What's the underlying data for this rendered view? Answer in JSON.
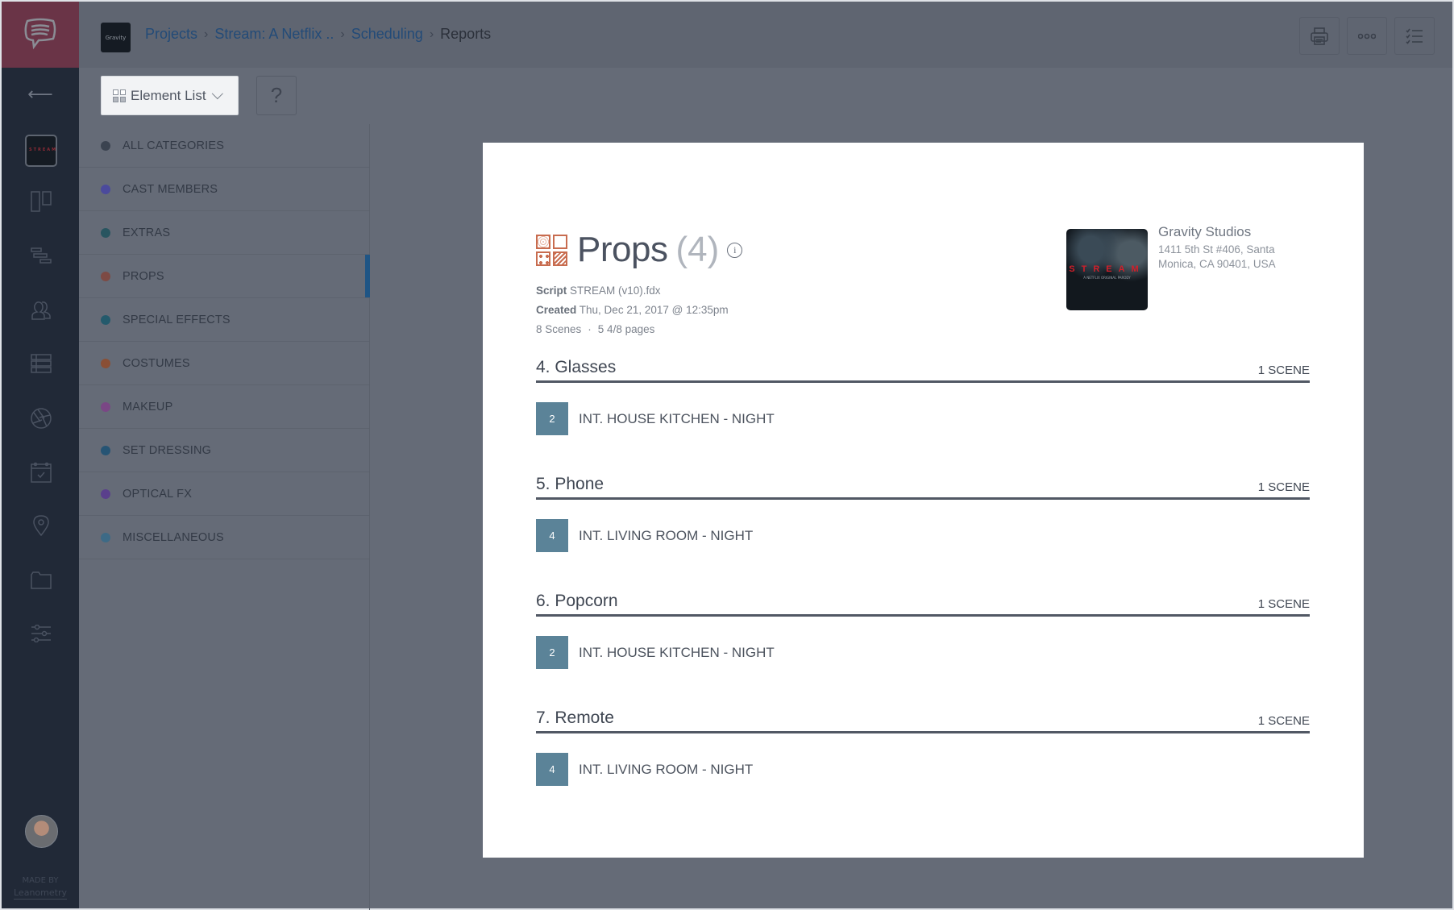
{
  "app": {
    "logo_icon": "chat-bubble-logo-icon",
    "made_by_label": "MADE BY",
    "made_by_brand": "Leanometry"
  },
  "rail": {
    "back_icon": "arrow-left-icon",
    "items": [
      {
        "name": "project-thumbnail",
        "label": "STREAM"
      },
      {
        "name": "board-icon"
      },
      {
        "name": "schedule-stripboard-icon"
      },
      {
        "name": "cast-icon"
      },
      {
        "name": "breakdown-list-icon"
      },
      {
        "name": "shot-aperture-icon"
      },
      {
        "name": "calendar-icon"
      },
      {
        "name": "location-pin-icon"
      },
      {
        "name": "folder-icon"
      },
      {
        "name": "settings-sliders-icon"
      }
    ]
  },
  "topbar": {
    "project_logo_text": "Gravity",
    "breadcrumb": [
      {
        "label": "Projects",
        "link": true
      },
      {
        "label": "Stream: A Netflix ..",
        "link": true
      },
      {
        "label": "Scheduling",
        "link": true
      },
      {
        "label": "Reports",
        "link": false
      }
    ],
    "actions": [
      {
        "name": "print-icon"
      },
      {
        "name": "more-options-icon"
      },
      {
        "name": "checklist-icon"
      }
    ]
  },
  "toolbar": {
    "view_selector": "Element List",
    "help_label": "?"
  },
  "categories": [
    {
      "label": "ALL CATEGORIES",
      "color": "#3b4350",
      "active": false
    },
    {
      "label": "CAST MEMBERS",
      "color": "#4b4a9c",
      "active": false
    },
    {
      "label": "EXTRAS",
      "color": "#285560",
      "active": false
    },
    {
      "label": "PROPS",
      "color": "#7d4a44",
      "active": true
    },
    {
      "label": "SPECIAL EFFECTS",
      "color": "#245a6c",
      "active": false
    },
    {
      "label": "COSTUMES",
      "color": "#8a4f35",
      "active": false
    },
    {
      "label": "MAKEUP",
      "color": "#7a4785",
      "active": false
    },
    {
      "label": "SET DRESSING",
      "color": "#265474",
      "active": false
    },
    {
      "label": "OPTICAL FX",
      "color": "#5a3f8c",
      "active": false
    },
    {
      "label": "MISCELLANEOUS",
      "color": "#3d6a86",
      "active": false
    }
  ],
  "report": {
    "category_icon": "props-category-icon",
    "title": "Props",
    "count": "(4)",
    "script_label": "Script",
    "script_value": "STREAM (v10).fdx",
    "created_label": "Created",
    "created_value": "Thu, Dec 21, 2017 @ 12:35pm",
    "scenes_summary": "8 Scenes",
    "pages_summary": "5 4/8 pages",
    "studio": {
      "poster_title": "STREAM",
      "poster_subtitle": "A NETFLIX ORIGINAL PARODY",
      "name": "Gravity Studios",
      "address": "1411 5th St #406, Santa Monica, CA 90401, USA"
    },
    "elements": [
      {
        "name": "4. Glasses",
        "count": "1 SCENE",
        "scenes": [
          {
            "number": "2",
            "heading": "INT. HOUSE KITCHEN - NIGHT"
          }
        ]
      },
      {
        "name": "5. Phone",
        "count": "1 SCENE",
        "scenes": [
          {
            "number": "4",
            "heading": "INT. LIVING ROOM - NIGHT"
          }
        ]
      },
      {
        "name": "6. Popcorn",
        "count": "1 SCENE",
        "scenes": [
          {
            "number": "2",
            "heading": "INT. HOUSE KITCHEN - NIGHT"
          }
        ]
      },
      {
        "name": "7. Remote",
        "count": "1 SCENE",
        "scenes": [
          {
            "number": "4",
            "heading": "INT. LIVING ROOM - NIGHT"
          }
        ]
      }
    ]
  }
}
